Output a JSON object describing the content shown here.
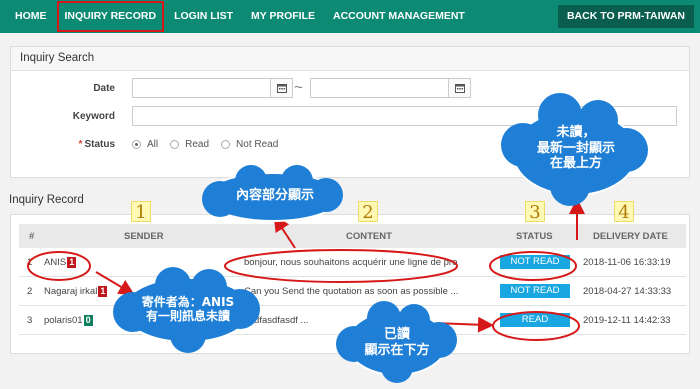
{
  "nav": {
    "items": [
      "HOME",
      "INQUIRY RECORD",
      "LOGIN LIST",
      "MY PROFILE",
      "ACCOUNT MANAGEMENT"
    ],
    "right": "BACK TO PRM-TAIWAN"
  },
  "search": {
    "title": "Inquiry Search",
    "date_label": "Date",
    "date_from": "",
    "date_to": "",
    "date_sep": "~",
    "keyword_label": "Keyword",
    "keyword_value": "",
    "status_label": "Status",
    "status_options": [
      "All",
      "Read",
      "Not Read"
    ],
    "status_selected": "All"
  },
  "record": {
    "title": "Inquiry Record",
    "columns": [
      "#",
      "SENDER",
      "CONTENT",
      "STATUS",
      "DELIVERY DATE"
    ],
    "rows": [
      {
        "num": "1",
        "sender": "ANIS",
        "count": "1",
        "count_color": "#c0171d",
        "content": "bonjour, nous souhaitons acquérir une ligne de pro",
        "status": "NOT READ",
        "date": "2018-11-06 16:33:19"
      },
      {
        "num": "2",
        "sender": "Nagaraj irkal",
        "count": "1",
        "count_color": "#c0171d",
        "content": "Can you Send the quotation as soon as possible ...",
        "status": "NOT READ",
        "date": "2018-04-27 14:33:33"
      },
      {
        "num": "3",
        "sender": "polaris01",
        "count": "0",
        "count_color": "#0f7e5e",
        "content": "asdfasdfasdf ...",
        "status": "READ",
        "date": "2019-12-11 14:42:33"
      }
    ]
  },
  "annotations": {
    "numbers": [
      "1",
      "2",
      "3",
      "4"
    ],
    "cloud_content": "內容部分顯示",
    "cloud_unread": [
      "未讀，",
      "最新一封顯示",
      "在最上方"
    ],
    "cloud_sender": [
      "寄件者為：ANIS",
      "有一則訊息未讀"
    ],
    "cloud_read": [
      "已讀",
      "顯示在下方"
    ]
  },
  "colors": {
    "nav_bg": "#0d8a74",
    "badge": "#18a7e0",
    "annotation_red": "#d61818",
    "cloud": "#1f7fd6"
  }
}
